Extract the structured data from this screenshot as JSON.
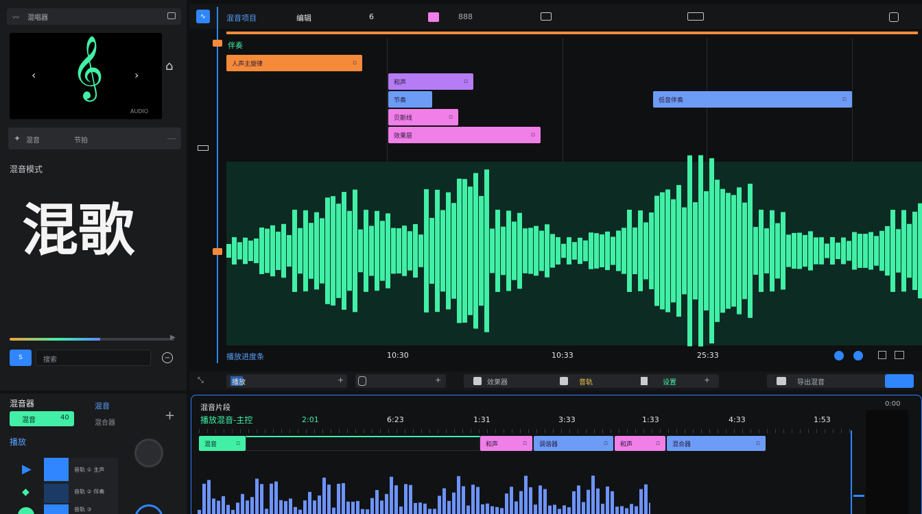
{
  "sidebar": {
    "title": "混唱器",
    "preview_label": "AUDIO",
    "track_row": {
      "a": "混音",
      "b": "节拍"
    },
    "section_label": "混音模式",
    "big_title": "混歌",
    "search_placeholder": "搜索",
    "search_button": "S"
  },
  "toolbar": {
    "project_name": "混音项目",
    "mode": "编辑",
    "item3": "6",
    "item4": "888",
    "right1": "",
    "right2": ""
  },
  "timeline": {
    "top_label": "伴奏",
    "clips": [
      {
        "label": "人声主旋律",
        "color": "#f58a3a"
      },
      {
        "label": "和声",
        "color": "#b57cf5"
      },
      {
        "label": "节奏",
        "color": "#6d9cf7"
      },
      {
        "label": "贝斯线",
        "color": "#f07fe8"
      },
      {
        "label": "效果层",
        "color": "#f07fe8"
      },
      {
        "label": "低音伴奏",
        "color": "#6d9cf7"
      }
    ],
    "bottom_label": "播放进度条",
    "ruler": [
      "10:30",
      "10:33",
      "25:33"
    ],
    "waveform_color": "#41f0a6"
  },
  "mixbar": {
    "a": "播放",
    "b": "",
    "c": "效果器",
    "d": "音轨",
    "e": "设置",
    "f": "导出混音",
    "g": "+"
  },
  "bottom_left": {
    "title": "混音器",
    "tab1": "混音",
    "tab1_count": "40",
    "side_label": "混音",
    "side_sub": "混合器",
    "section2": "播放",
    "list": [
      "音轨 ① 主声",
      "音轨 ② 伴奏",
      "音轨 ③"
    ]
  },
  "bottom_main": {
    "title": "混音片段",
    "subtitle": "播放混音-主控",
    "ruler": [
      "2:01",
      "6:23",
      "1:31",
      "3:33",
      "1:33",
      "4:33",
      "1:53"
    ],
    "clips": [
      {
        "label": "混音",
        "color": "#41f0a6"
      },
      {
        "label": "和声",
        "color": "#f07fe8"
      },
      {
        "label": "调谐器",
        "color": "#6d9cf7"
      },
      {
        "label": "和声",
        "color": "#f07fe8"
      },
      {
        "label": "混合器",
        "color": "#6d9cf7"
      }
    ],
    "time": "0:00"
  }
}
